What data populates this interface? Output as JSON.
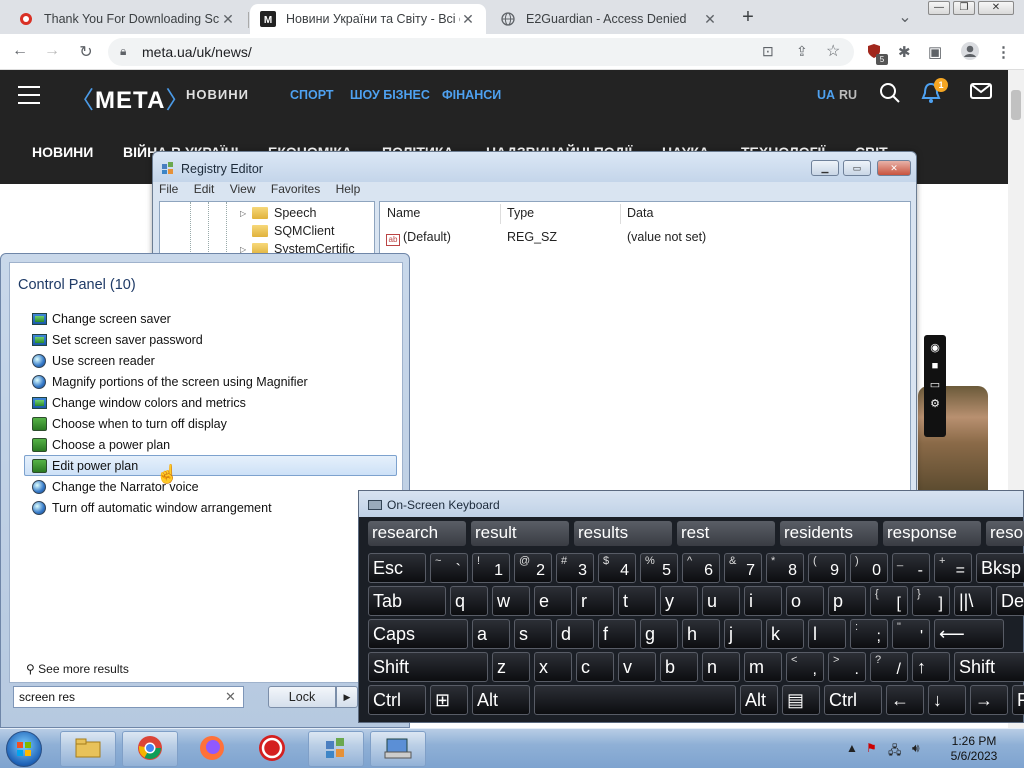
{
  "browser": {
    "tabs": [
      {
        "title": "Thank You For Downloading Scre"
      },
      {
        "title": "Новини України та Світу - Всі сі"
      },
      {
        "title": "E2Guardian - Access Denied"
      }
    ],
    "url": "meta.ua/uk/news/",
    "extension_badge": "5"
  },
  "site": {
    "logo": "МЕТА",
    "logo_sub": "НОВИНИ",
    "top_nav": [
      "СПОРТ",
      "ШОУ БІЗНЕС",
      "ФІНАНСИ"
    ],
    "lang_ua": "UA",
    "lang_ru": "RU",
    "notif_count": "1",
    "categories": [
      "НОВИНИ",
      "ВІЙНА В УКРАЇНІ",
      "ЕКОНОМІКА",
      "ПОЛІТИКА",
      "НАДЗВИЧАЙНІ ПОДІЇ",
      "НАУКА",
      "ТЕХНОЛОГІЇ",
      "СВІТ"
    ]
  },
  "regedit": {
    "title": "Registry Editor",
    "menu": [
      "File",
      "Edit",
      "View",
      "Favorites",
      "Help"
    ],
    "tree": [
      "Speech",
      "SQMClient",
      "SystemCertific"
    ],
    "columns": [
      "Name",
      "Type",
      "Data"
    ],
    "rows": [
      {
        "name": "(Default)",
        "type": "REG_SZ",
        "data": "(value not set)"
      }
    ]
  },
  "startmenu": {
    "section_title": "Control Panel (10)",
    "items": [
      {
        "label": "Change screen saver",
        "icon": "monitor-icon"
      },
      {
        "label": "Set screen saver password",
        "icon": "monitor-icon"
      },
      {
        "label": "Use screen reader",
        "icon": "ease-of-access-icon"
      },
      {
        "label": "Magnify portions of the screen using Magnifier",
        "icon": "ease-of-access-icon"
      },
      {
        "label": "Change window colors and metrics",
        "icon": "monitor-icon"
      },
      {
        "label": "Choose when to turn off display",
        "icon": "power-options-icon"
      },
      {
        "label": "Choose a power plan",
        "icon": "power-options-icon"
      },
      {
        "label": "Edit power plan",
        "icon": "power-options-icon"
      },
      {
        "label": "Change the Narrator voice",
        "icon": "ease-of-access-icon"
      },
      {
        "label": "Turn off automatic window arrangement",
        "icon": "ease-of-access-icon"
      }
    ],
    "highlighted_index": 7,
    "see_more": "See more results",
    "search_value": "screen res",
    "lock_label": "Lock"
  },
  "osk": {
    "title": "On-Screen Keyboard",
    "suggestions": [
      "research",
      "result",
      "results",
      "rest",
      "residents",
      "response",
      "resource"
    ],
    "rows": [
      [
        "Esc",
        "~|`",
        "!|1",
        "@|2",
        "#|3",
        "$|4",
        "%|5",
        "^|6",
        "&|7",
        "*|8",
        "(|9",
        ")|0",
        "_|-",
        "+|=",
        "Bksp"
      ],
      [
        "Tab",
        "q",
        "w",
        "e",
        "r",
        "t",
        "y",
        "u",
        "i",
        "o",
        "p",
        "{|[",
        "}|]",
        "||\\",
        "Del"
      ],
      [
        "Caps",
        "a",
        "s",
        "d",
        "f",
        "g",
        "h",
        "j",
        "k",
        "l",
        ":|;",
        "\"|'",
        "⟵"
      ],
      [
        "Shift",
        "z",
        "x",
        "c",
        "v",
        "b",
        "n",
        "m",
        "<|,",
        ">|.",
        "?|/",
        "↑",
        "Shift"
      ],
      [
        "Ctrl",
        "⊞",
        "Alt",
        "",
        "Alt",
        "▤",
        "Ctrl",
        "←",
        "↓",
        "→",
        "Fn"
      ]
    ]
  },
  "taskbar": {
    "time": "1:26 PM",
    "date": "5/6/2023"
  }
}
